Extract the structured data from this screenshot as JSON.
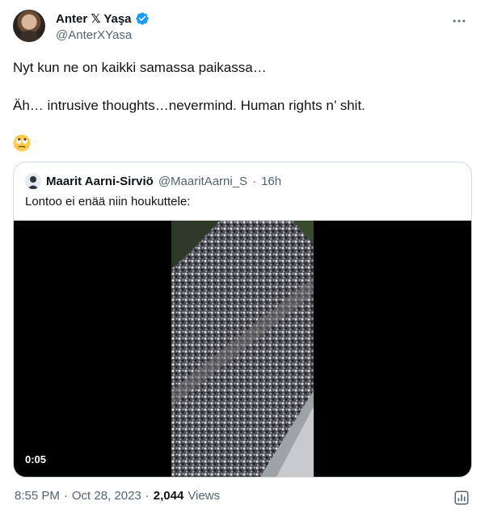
{
  "author": {
    "display_name": "Anter 𝕏 Yaşa",
    "handle": "@AnterXYasa"
  },
  "tweet": {
    "line1": "Nyt kun ne on kaikki samassa paikassa…",
    "line2": "Äh… intrusive thoughts…nevermind. Human rights n’ shit.",
    "emoji": "face-with-rolling-eyes"
  },
  "quote": {
    "display_name": "Maarit Aarni-Sirviö",
    "handle": "@MaaritAarni_S",
    "separator": "·",
    "time": "16h",
    "text": "Lontoo ei enää niin houkuttele:",
    "video_duration": "0:05"
  },
  "footer": {
    "time": "8:55 PM",
    "separator": "·",
    "date": "Oct 28, 2023",
    "separator2": "·",
    "views_count": "2,044",
    "views_label": "Views"
  },
  "colors": {
    "accent": "#1d9bf0",
    "text": "#0f1419",
    "secondary": "#536471",
    "border": "#cfd9de"
  }
}
